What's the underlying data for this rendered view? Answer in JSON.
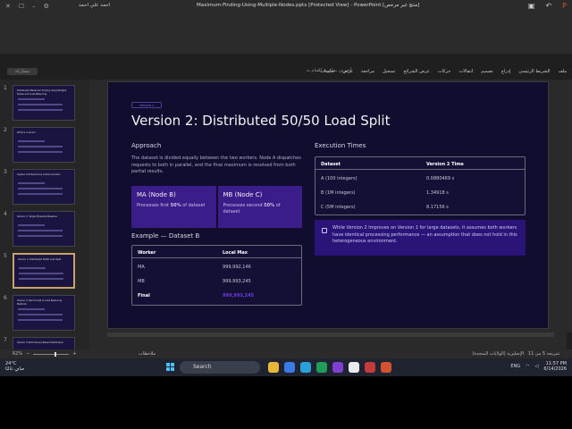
{
  "window": {
    "title": "[منتج غير مرخص] Maximum-Finding-Using-Multiple-Nodes.pptx [Protected View] - PowerPoint",
    "user": "احمد علي احمد"
  },
  "ribbon": {
    "tabs": [
      "ملف",
      "الشريط الرئيسي",
      "إدراج",
      "تصميم",
      "انتقالات",
      "حركات",
      "عرض الشرائح",
      "تسجيل",
      "مراجعة",
      "عرض",
      "تعليمات"
    ],
    "search_placeholder": "أخبرني بما تريد القيام به",
    "left_button": "مشاركة"
  },
  "thumbnails": [
    {
      "num": "1",
      "title": "Distributed Maximum Finding Using Multiple Nodes and Load Balancing"
    },
    {
      "num": "2",
      "title": "What is a sensor"
    },
    {
      "num": "3",
      "title": "System Architecture & Communication"
    },
    {
      "num": "4",
      "title": "Version 1: Single-Threaded Baseline"
    },
    {
      "num": "5",
      "title": "Version 2: Distributed 50/50 Load Split"
    },
    {
      "num": "6",
      "title": "Version 3: Benchmark & Load Balancing Methods"
    },
    {
      "num": "7",
      "title": "Version 3 Performance-Based Distribution"
    }
  ],
  "slide": {
    "tag": "VERSION 2",
    "title": "Version 2: Distributed 50/50 Load Split",
    "approach": {
      "heading": "Approach",
      "text": "The dataset is divided equally between the two workers. Node A dispatches requests to both in parallel, and the final maximum is resolved from both partial results."
    },
    "cards": [
      {
        "title": "MA (Node B)",
        "pre": "Processes first ",
        "bold": "50%",
        "post": " of dataset"
      },
      {
        "title": "MB (Node C)",
        "pre": "Processes second ",
        "bold": "50%",
        "post": " of dataset"
      }
    ],
    "example": {
      "heading": "Example — Dataset B",
      "headers": [
        "Worker",
        "Local Max"
      ],
      "rows": [
        [
          "MA",
          "999,992,146"
        ],
        [
          "MB",
          "999,993,245"
        ],
        [
          "Final",
          "999,993,245"
        ]
      ]
    },
    "exec": {
      "heading": "Execution Times",
      "headers": [
        "Dataset",
        "Version 2 Time"
      ],
      "rows": [
        [
          "A (100 integers)",
          "0.0880469 s"
        ],
        [
          "B (1M integers)",
          "1.34918 s"
        ],
        [
          "C (5M integers)",
          "8.17156 s"
        ]
      ]
    },
    "note": "While Version 2 improves on Version 1 for large datasets, it assumes both workers have identical processing performance — an assumption that does not hold in this heterogeneous environment."
  },
  "status": {
    "zoom": "62%",
    "notes": "ملاحظات",
    "slide_info": "شريحة 5 من 11",
    "lang": "الإنجليزية (الولايات المتحدة)"
  },
  "taskbar": {
    "temp": "24°C",
    "weather": "صافٍ غالبًا",
    "search": "Search",
    "lang": "ENG",
    "time": "11:57 PM",
    "date": "6/14/2026"
  }
}
